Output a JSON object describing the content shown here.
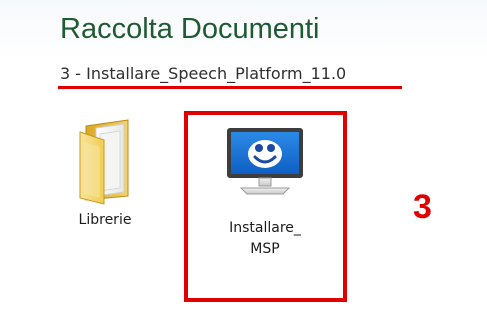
{
  "window": {
    "title": "Raccolta Documenti",
    "breadcrumb": "3 - Installare_Speech_Platform_11.0"
  },
  "files": [
    {
      "label": "Librerie",
      "icon": "folder-icon"
    },
    {
      "label_line1": "Installare_",
      "label_line2": "MSP",
      "icon": "installer-monitor-icon"
    }
  ],
  "annotation": {
    "step_number": "3"
  },
  "colors": {
    "title_green": "#1e5a32",
    "annotation_red": "#e00000"
  }
}
